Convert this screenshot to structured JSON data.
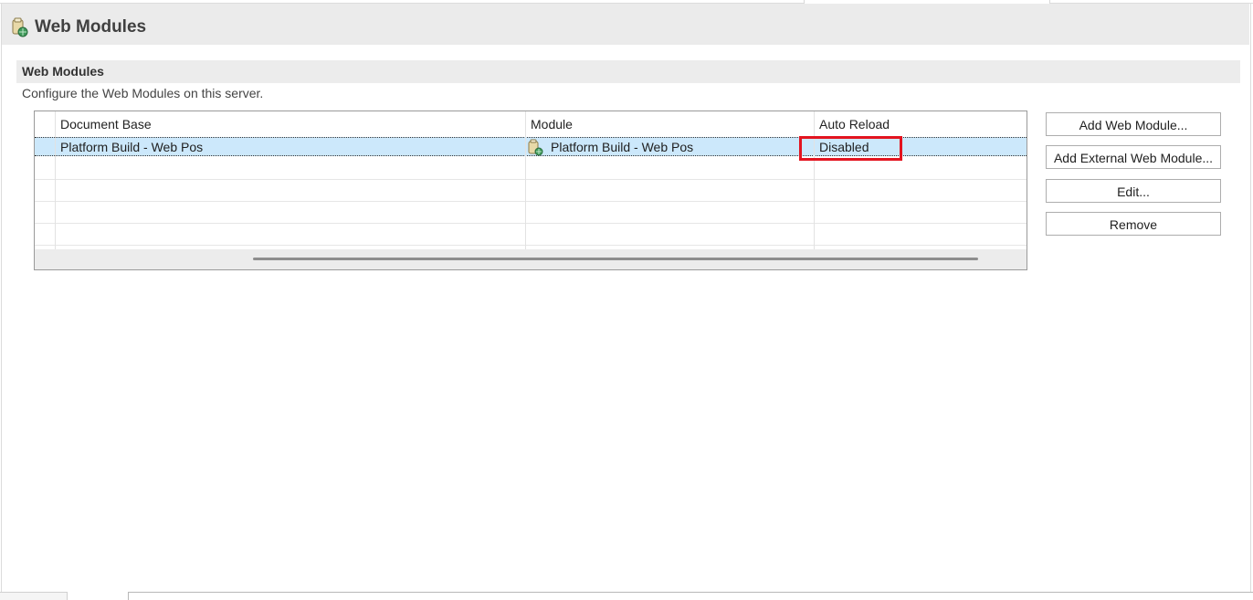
{
  "header": {
    "title": "Web Modules",
    "icon": "web-module-icon"
  },
  "section": {
    "title": "Web Modules",
    "description": "Configure the Web Modules on this server."
  },
  "table": {
    "columns": [
      "Document Base",
      "Module",
      "Auto Reload"
    ],
    "rows": [
      {
        "document_base": "Platform Build - Web Pos",
        "module": "Platform Build - Web Pos",
        "module_icon": "web-module-icon",
        "auto_reload": "Disabled",
        "selected": true
      }
    ]
  },
  "buttons": {
    "add_web_module": "Add Web Module...",
    "add_external_web_module": "Add External Web Module...",
    "edit": "Edit...",
    "remove": "Remove"
  },
  "colors": {
    "selection": "#cce8fb",
    "highlight_box": "#e3141f",
    "header_bg": "#ebebeb"
  }
}
